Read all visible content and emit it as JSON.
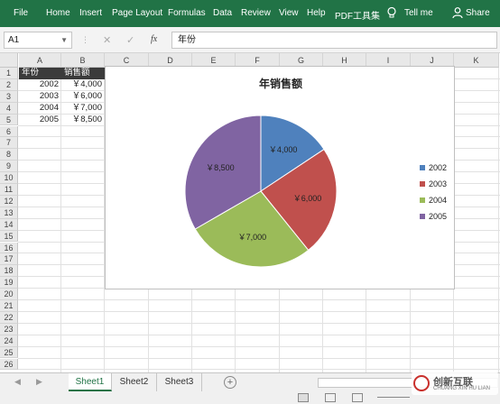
{
  "ribbon": {
    "tabs": [
      {
        "label": "File"
      },
      {
        "label": "Home"
      },
      {
        "label": "Insert"
      },
      {
        "label": "Page Layout"
      },
      {
        "label": "Formulas"
      },
      {
        "label": "Data"
      },
      {
        "label": "Review"
      },
      {
        "label": "View"
      },
      {
        "label": "Help"
      },
      {
        "label": "PDF工具集"
      }
    ],
    "tell_me": "Tell me",
    "share": "Share",
    "color": "#217346"
  },
  "formula_bar": {
    "name_box": "A1",
    "fx_label": "fx",
    "content": "年份"
  },
  "grid": {
    "columns": [
      "A",
      "B",
      "C",
      "D",
      "E",
      "F",
      "G",
      "H",
      "I",
      "J",
      "K"
    ],
    "rows": [
      "1",
      "2",
      "3",
      "4",
      "5",
      "6",
      "7",
      "8",
      "9",
      "10",
      "11",
      "12",
      "13",
      "14",
      "15",
      "16",
      "17",
      "18",
      "19",
      "20",
      "21",
      "22",
      "23",
      "24",
      "25",
      "26"
    ],
    "headers": {
      "a1": "年份",
      "b1": "销售额"
    },
    "data": [
      {
        "year": "2002",
        "sales": "￥4,000"
      },
      {
        "year": "2003",
        "sales": "￥6,000"
      },
      {
        "year": "2004",
        "sales": "￥7,000"
      },
      {
        "year": "2005",
        "sales": "￥8,500"
      }
    ]
  },
  "chart_data": {
    "type": "pie",
    "title": "年销售额",
    "categories": [
      "2002",
      "2003",
      "2004",
      "2005"
    ],
    "values": [
      4000,
      6000,
      7000,
      8500
    ],
    "data_labels": [
      "￥4,000",
      "￥6,000",
      "￥7,000",
      "￥8,500"
    ],
    "colors": [
      "#4f81bd",
      "#c0504d",
      "#9bbb59",
      "#8064a2"
    ],
    "legend_position": "right"
  },
  "sheet_tabs": [
    {
      "label": "Sheet1",
      "active": true
    },
    {
      "label": "Sheet2",
      "active": false
    },
    {
      "label": "Sheet3",
      "active": false
    }
  ],
  "watermark": {
    "text": "创新互联",
    "sub": "CHUANG XIN HU LIAN"
  }
}
